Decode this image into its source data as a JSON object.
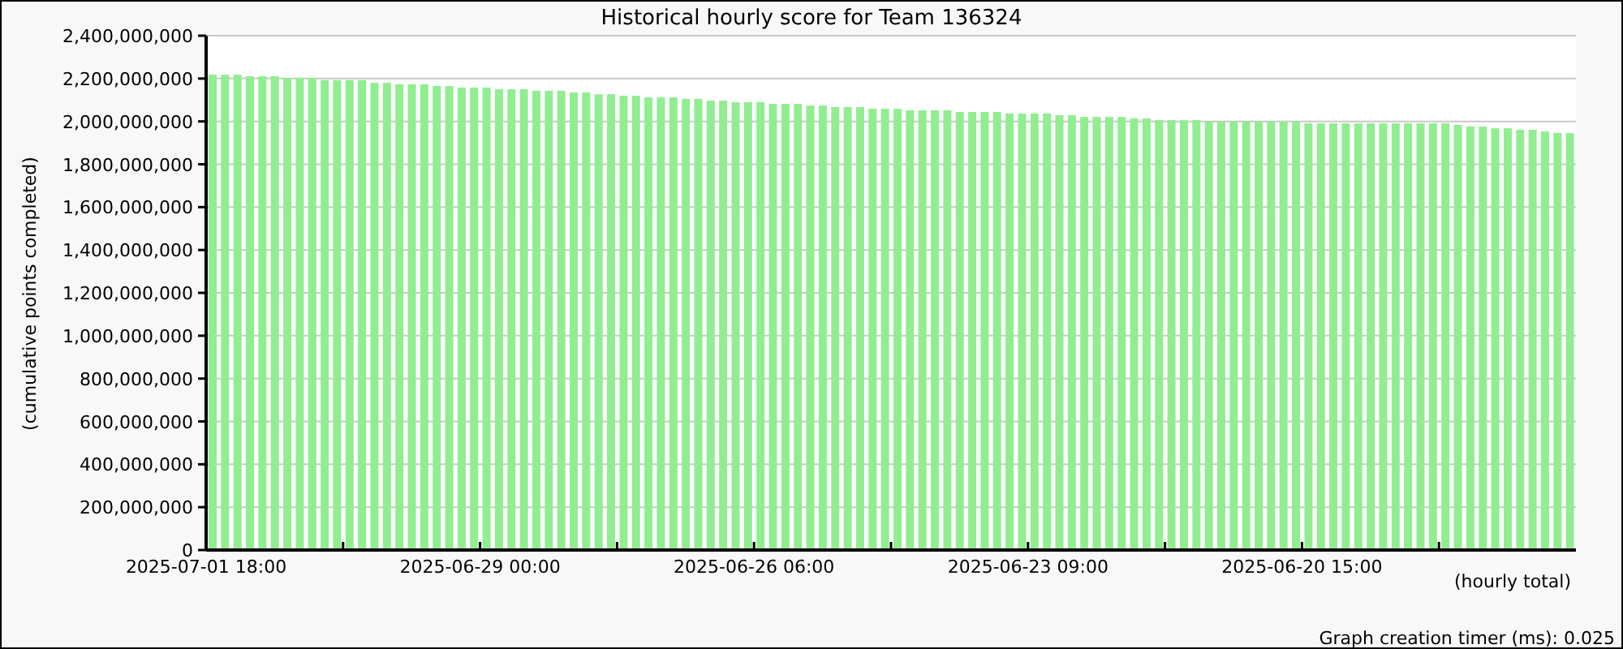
{
  "chart_data": {
    "type": "bar",
    "title": "Historical hourly score for Team 136324",
    "xlabel": "(hourly total)",
    "ylabel": "(cumulative points completed)",
    "ylim": [
      0,
      2400000000
    ],
    "yticks": [
      {
        "value": 0,
        "label": "0"
      },
      {
        "value": 200000000,
        "label": "200,000,000"
      },
      {
        "value": 400000000,
        "label": "400,000,000"
      },
      {
        "value": 600000000,
        "label": "600,000,000"
      },
      {
        "value": 800000000,
        "label": "800,000,000"
      },
      {
        "value": 1000000000,
        "label": "1,000,000,000"
      },
      {
        "value": 1200000000,
        "label": "1,200,000,000"
      },
      {
        "value": 1400000000,
        "label": "1,400,000,000"
      },
      {
        "value": 1600000000,
        "label": "1,600,000,000"
      },
      {
        "value": 1800000000,
        "label": "1,800,000,000"
      },
      {
        "value": 2000000000,
        "label": "2,000,000,000"
      },
      {
        "value": 2200000000,
        "label": "2,200,000,000"
      },
      {
        "value": 2400000000,
        "label": "2,400,000,000"
      }
    ],
    "grid": true,
    "categories": [
      "2025-07-01 18:00",
      null,
      null,
      null,
      null,
      null,
      null,
      null,
      null,
      null,
      null,
      null,
      null,
      null,
      null,
      null,
      null,
      null,
      null,
      null,
      null,
      null,
      "2025-06-29 00:00",
      null,
      null,
      null,
      null,
      null,
      null,
      null,
      null,
      null,
      null,
      null,
      null,
      null,
      null,
      null,
      null,
      null,
      null,
      null,
      null,
      null,
      "2025-06-26 06:00",
      null,
      null,
      null,
      null,
      null,
      null,
      null,
      null,
      null,
      null,
      null,
      null,
      null,
      null,
      null,
      null,
      null,
      null,
      null,
      null,
      null,
      "2025-06-23 09:00",
      null,
      null,
      null,
      null,
      null,
      null,
      null,
      null,
      null,
      null,
      null,
      null,
      null,
      null,
      null,
      null,
      null,
      null,
      null,
      null,
      null,
      "2025-06-20 15:00",
      null,
      null,
      null,
      null,
      null,
      null,
      null,
      null,
      null,
      null,
      null,
      null,
      null,
      null,
      null,
      null,
      null,
      null,
      null,
      null,
      null
    ],
    "series": [
      {
        "color": "#90ee90",
        "values": [
          2218000000,
          2218000000,
          2218000000,
          2211000000,
          2211000000,
          2211000000,
          2203000000,
          2203000000,
          2203000000,
          2193000000,
          2193000000,
          2193000000,
          2193000000,
          2180000000,
          2180000000,
          2173000000,
          2173000000,
          2173000000,
          2165000000,
          2165000000,
          2158000000,
          2158000000,
          2158000000,
          2150000000,
          2150000000,
          2150000000,
          2143000000,
          2143000000,
          2143000000,
          2135000000,
          2135000000,
          2127000000,
          2127000000,
          2120000000,
          2120000000,
          2112000000,
          2112000000,
          2112000000,
          2105000000,
          2105000000,
          2097000000,
          2097000000,
          2090000000,
          2090000000,
          2090000000,
          2082000000,
          2082000000,
          2082000000,
          2074000000,
          2074000000,
          2067000000,
          2067000000,
          2067000000,
          2059000000,
          2059000000,
          2059000000,
          2052000000,
          2052000000,
          2052000000,
          2052000000,
          2044000000,
          2044000000,
          2044000000,
          2044000000,
          2037000000,
          2037000000,
          2037000000,
          2037000000,
          2029000000,
          2029000000,
          2021000000,
          2021000000,
          2021000000,
          2021000000,
          2014000000,
          2014000000,
          2006000000,
          2006000000,
          2006000000,
          2006000000,
          1999000000,
          1999000000,
          1999000000,
          1999000000,
          1999000000,
          1999000000,
          1999000000,
          1999000000,
          1991000000,
          1991000000,
          1991000000,
          1991000000,
          1991000000,
          1991000000,
          1991000000,
          1991000000,
          1991000000,
          1991000000,
          1991000000,
          1991000000,
          1984000000,
          1976000000,
          1976000000,
          1968000000,
          1968000000,
          1961000000,
          1961000000,
          1953000000,
          1946000000,
          1946000000
        ]
      }
    ]
  },
  "footer": "Graph creation timer (ms): 0.025"
}
